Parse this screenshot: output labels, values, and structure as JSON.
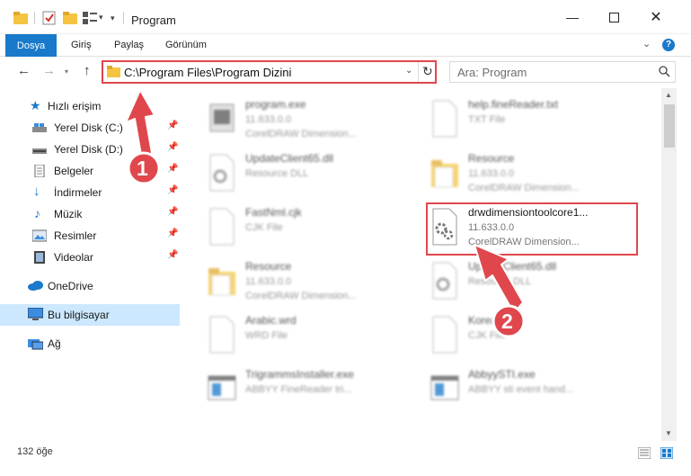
{
  "window": {
    "title": "Program"
  },
  "ribbon": {
    "tabs": [
      "Dosya",
      "Giriş",
      "Paylaş",
      "Görünüm"
    ]
  },
  "navigation": {
    "address": "C:\\Program Files\\Program Dizini",
    "search_placeholder": "Ara: Program"
  },
  "sidebar": {
    "items": [
      {
        "label": "Hızlı erişim",
        "icon": "star-icon"
      },
      {
        "label": "Yerel Disk (C:)",
        "icon": "drive-icon"
      },
      {
        "label": "Yerel Disk (D:)",
        "icon": "drive-icon"
      },
      {
        "label": "Belgeler",
        "icon": "documents-icon"
      },
      {
        "label": "İndirmeler",
        "icon": "download-icon"
      },
      {
        "label": "Müzik",
        "icon": "music-icon"
      },
      {
        "label": "Resimler",
        "icon": "pictures-icon"
      },
      {
        "label": "Videolar",
        "icon": "video-icon"
      },
      {
        "label": "OneDrive",
        "icon": "cloud-icon"
      },
      {
        "label": "Bu bilgisayar",
        "icon": "computer-icon"
      },
      {
        "label": "Ağ",
        "icon": "network-icon"
      }
    ]
  },
  "files": [
    {
      "name": "program.exe",
      "line1": "11.633.0.0",
      "line2": "CorelDRAW Dimension...",
      "kind": "exe"
    },
    {
      "name": "help.fineReader.txt",
      "line1": "TXT File",
      "line2": "",
      "kind": "doc"
    },
    {
      "name": "UpdateClient65.dll",
      "line1": "Resource DLL",
      "line2": "",
      "kind": "dll"
    },
    {
      "name": "Resource",
      "line1": "11.633.0.0",
      "line2": "CorelDRAW Dimension...",
      "kind": "folder"
    },
    {
      "name": "FastNml.cjk",
      "line1": "CJK File",
      "line2": "",
      "kind": "doc"
    },
    {
      "name": "drwdimensiontoolcore1...",
      "line1": "11.633.0.0",
      "line2": "CorelDRAW Dimension...",
      "kind": "dll"
    },
    {
      "name": "Resource",
      "line1": "11.633.0.0",
      "line2": "CorelDRAW Dimension...",
      "kind": "folder"
    },
    {
      "name": "UpdateClient65.dll",
      "line1": "Resource DLL",
      "line2": "",
      "kind": "dll"
    },
    {
      "name": "Arabic.wrd",
      "line1": "WRD File",
      "line2": "",
      "kind": "doc"
    },
    {
      "name": "Korean.cjk",
      "line1": "CJK File",
      "line2": "",
      "kind": "doc"
    },
    {
      "name": "TrigrammsInstaller.exe",
      "line1": "ABBYY FineReader tri...",
      "line2": "",
      "kind": "app"
    },
    {
      "name": "AbbyySTI.exe",
      "line1": "ABBYY sti event hand...",
      "line2": "",
      "kind": "app"
    }
  ],
  "annotations": {
    "step1": "1",
    "step2": "2",
    "color": "#e0474c"
  },
  "status": {
    "count": "132 öğe"
  },
  "colors": {
    "accent": "#1979ca",
    "selected": "#cce8ff",
    "highlight": "#e0474c"
  }
}
